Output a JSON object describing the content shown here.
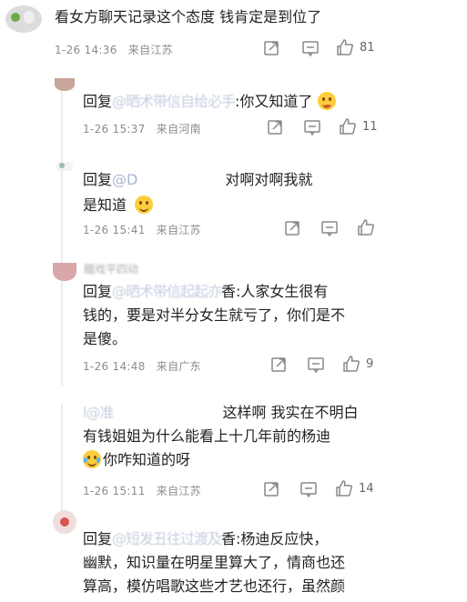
{
  "main_comment": {
    "text": "看女方聊天记录这个态度 钱肯定是到位了",
    "date": "1-26 14:36",
    "location": "来自江苏",
    "likes": "81"
  },
  "replies": [
    {
      "prefix": "回复",
      "mention_blur": "@晒术带信自给必手",
      "text_after": ":你又知道了",
      "emoji": "tongue-emoji",
      "date": "1-26 15:37",
      "location": "来自河南",
      "likes": "11"
    },
    {
      "prefix": "回复",
      "mention": "@D",
      "text_line1": "对啊对啊我就",
      "text_line2": "是知道",
      "emoji": "smile-emoji",
      "date": "1-26 15:41",
      "location": "来自江苏",
      "likes": ""
    },
    {
      "name_blur": "腼戏平四动",
      "prefix": "回复",
      "mention_blur": "@晒术带信起起亦",
      "text_line1_after": "香:人家女生很有",
      "text_line2": "钱的，要是对半分女生就亏了，你们是不",
      "text_line3": "是傻。",
      "date": "1-26 14:48",
      "location": "来自广东",
      "likes": "9"
    },
    {
      "prefix_blur": "l",
      "mention_blur": "@准",
      "text_line1": "这样啊 我实在不明白",
      "text_line2": "有钱姐姐为什么能看上十几年前的杨迪",
      "text_line3": "你咋知道的呀",
      "emoji": "laugh-cry-emoji",
      "date": "1-26 15:11",
      "location": "来自江苏",
      "likes": "14"
    },
    {
      "prefix": "回复",
      "mention_blur": "@短发丑往过渡及",
      "text_line1_after": "香:杨迪反应快，",
      "text_line2": "幽默，知识量在明星里算大了，情商也还",
      "text_line3": "算高，模仿唱歌这些才艺也还行，虽然颜"
    }
  ],
  "colors": {
    "text": "#222222",
    "meta": "#8c8c8c",
    "mention": "#5b7fbd",
    "icon": "#888888"
  }
}
